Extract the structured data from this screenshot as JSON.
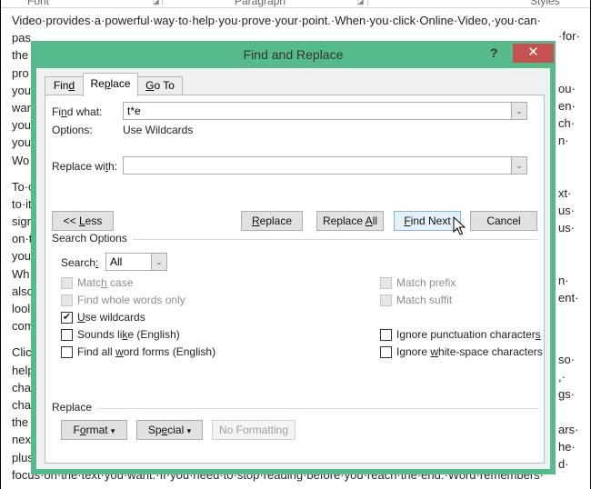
{
  "ribbon": {
    "groups": [
      "Font",
      "Paragraph",
      "Styles"
    ]
  },
  "document": {
    "lines": [
      "Video·provides·a·powerful·way·to·help·you·prove·your·point.·When·you·click·Online·Video,·you·can·",
      "pas",
      "the",
      "pro",
      "you",
      "war",
      "you",
      "you",
      "Wo",
      "To·c",
      "to·it",
      "sign",
      "on·t",
      "you",
      "Wh",
      "also",
      "lool",
      "com",
      "Clic",
      "help",
      "cha",
      "cha",
      "the",
      "nex",
      "plus",
      "focus·on·the·text·you·want.·If·you·need·to·stop·reading·before·you·reach·the·end.·Word·remembers·"
    ],
    "right_fragments": [
      "·for·",
      "",
      "ou·",
      "en·",
      "ch·",
      "n·",
      "xt·",
      "us·",
      "us·",
      "n·",
      "ent·",
      "so·",
      ",·",
      "gs·",
      "ars·",
      "he·",
      "d·"
    ]
  },
  "dialog": {
    "title": "Find and Replace",
    "help_label": "?",
    "close_label": "✕",
    "tabs": [
      {
        "pre": "Fin",
        "key": "d",
        "post": "",
        "active": false
      },
      {
        "pre": "Re",
        "key": "p",
        "post": "lace",
        "active": true
      },
      {
        "pre": "",
        "key": "G",
        "post": "o To",
        "active": false
      }
    ],
    "find_what": {
      "label_pre": "Fi",
      "label_key": "n",
      "label_post": "d what:",
      "value": "t*e"
    },
    "options": {
      "label": "Options:",
      "value": "Use Wildcards"
    },
    "replace_with": {
      "label_pre": "Replace wi",
      "label_key": "t",
      "label_post": "h:",
      "value": ""
    },
    "buttons": {
      "less": {
        "pre": "<< ",
        "key": "L",
        "post": "ess"
      },
      "replace": {
        "pre": "",
        "key": "R",
        "post": "eplace"
      },
      "replace_all": {
        "pre": "Replace ",
        "key": "A",
        "post": "ll"
      },
      "find_next": {
        "pre": "",
        "key": "F",
        "post": "ind Next"
      },
      "cancel": "Cancel"
    },
    "search_options": {
      "title": "Search Options",
      "search_label_pre": "Search",
      "search_label_key": ":",
      "search_value": "All",
      "left_checks": [
        {
          "pre": "Matc",
          "key": "h",
          "post": " case",
          "checked": false,
          "disabled": true
        },
        {
          "pre": "Find wh",
          "key": "o",
          "post": "le words only",
          "checked": false,
          "disabled": true
        },
        {
          "pre": "",
          "key": "U",
          "post": "se wildcards",
          "checked": true,
          "disabled": false
        },
        {
          "pre": "Sounds li",
          "key": "k",
          "post": "e (English)",
          "checked": false,
          "disabled": false
        },
        {
          "pre": "Find all ",
          "key": "w",
          "post": "ord forms (English)",
          "checked": false,
          "disabled": false
        }
      ],
      "right_checks": [
        {
          "pre": "Match prefi",
          "key": "x",
          "post": "",
          "checked": false,
          "disabled": true
        },
        {
          "pre": "Match suffi",
          "key": "t",
          "post": "",
          "checked": false,
          "disabled": true
        },
        {
          "pre": "Ignore punctuation character",
          "key": "s",
          "post": "",
          "checked": false,
          "disabled": false
        },
        {
          "pre": "Ignore ",
          "key": "w",
          "post": "hite-space characters",
          "checked": false,
          "disabled": false
        }
      ]
    },
    "replace_group": {
      "title": "Replace",
      "format": {
        "pre": "F",
        "key": "o",
        "post": "rmat"
      },
      "special": {
        "pre": "Sp",
        "key": "e",
        "post": "cial"
      },
      "no_formatting": "No Formatting",
      "dropdown_glyph": "▾"
    },
    "combo_arrow_glyph": "⌄",
    "check_glyph": "✔"
  },
  "colors": {
    "dialog_frame": "#56bb8a",
    "close_button": "#c75050",
    "focus_button_border": "#7eb4ea"
  }
}
